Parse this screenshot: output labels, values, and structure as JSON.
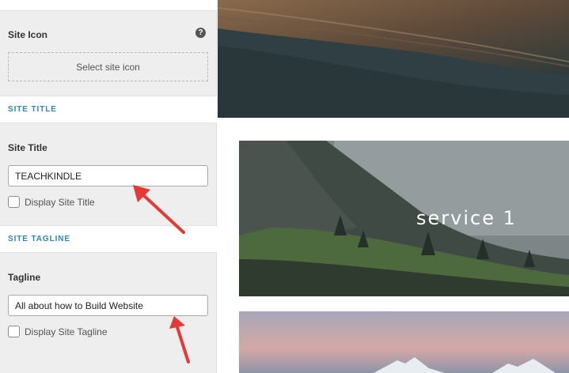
{
  "sidebar": {
    "site_icon": {
      "label": "Site Icon",
      "help_icon": "question-circle-icon",
      "select_button_label": "Select site icon"
    },
    "site_title_section": {
      "heading": "SITE TITLE",
      "label": "Site Title",
      "input_value": "TEACHKINDLE",
      "checkbox_label": "Display Site Title",
      "checkbox_checked": false
    },
    "site_tagline_section": {
      "heading": "SITE TAGLINE",
      "label": "Tagline",
      "input_value": "All about how to Build Website",
      "checkbox_label": "Display Site Tagline",
      "checkbox_checked": false
    }
  },
  "preview": {
    "service_card": {
      "title": "service 1"
    }
  },
  "colors": {
    "section_heading": "#2f86b8",
    "arrow": "#e53935",
    "panel_background": "#eeeeee"
  }
}
